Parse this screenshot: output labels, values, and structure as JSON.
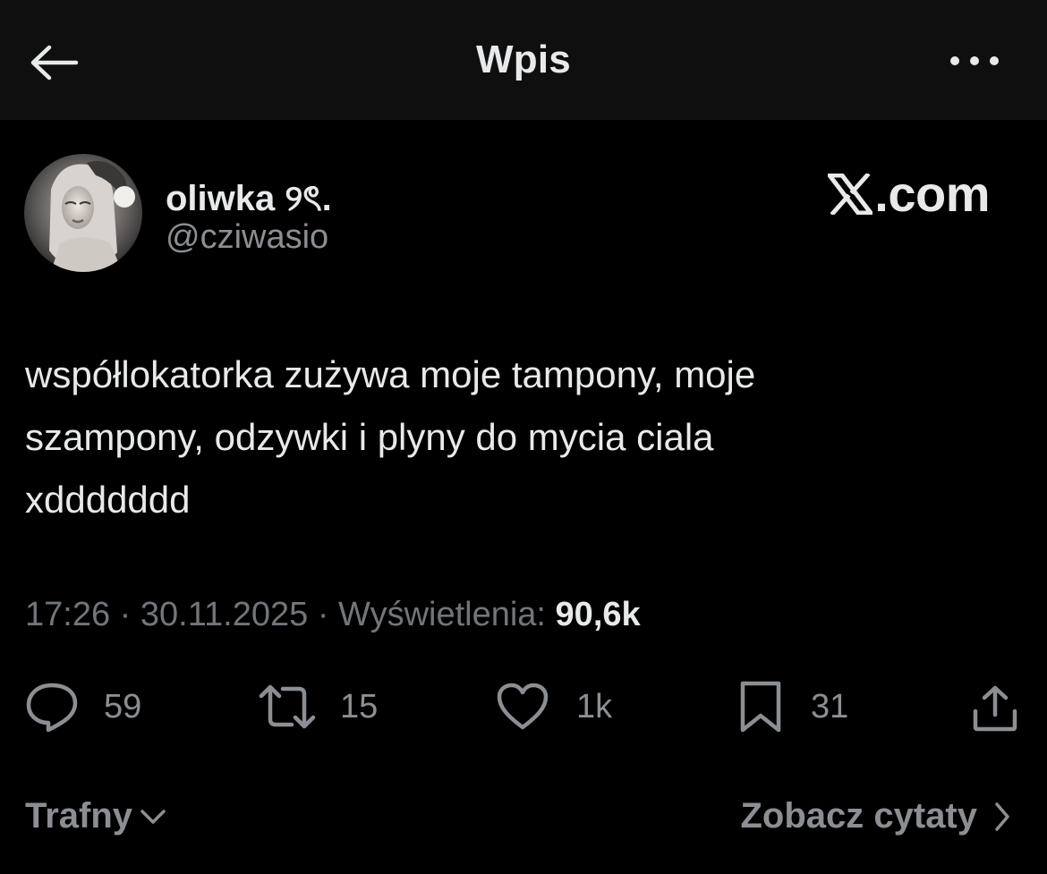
{
  "header": {
    "title": "Wpis",
    "back_icon": "arrow-left-icon",
    "more_icon": "more-horizontal-icon"
  },
  "author": {
    "display_name": "oliwka ୨ৎ.",
    "handle": "@cziwasio",
    "avatar_icon": "avatar-photo"
  },
  "watermark": {
    "suffix": ".com",
    "logo_icon": "x-logo-icon"
  },
  "tweet": {
    "lines": [
      "współlokatorka zużywa moje tampony, moje",
      "szampony, odzywki i plyny do mycia ciala",
      "xddddddd"
    ]
  },
  "meta": {
    "time": "17:26",
    "sep1": " · ",
    "date": "30.11.2025",
    "sep2": " · ",
    "views_label": "Wyświetlenia: ",
    "views_value": "90,6k"
  },
  "actions": {
    "replies": "59",
    "reposts": "15",
    "likes": "1k",
    "bookmarks": "31"
  },
  "footer": {
    "sort_label": "Trafny",
    "quotes_label": "Zobacz cytaty"
  },
  "colors": {
    "background": "#000000",
    "header_bg": "#0f0f10",
    "text_primary": "#e7e9ea",
    "text_secondary": "#71767b"
  }
}
